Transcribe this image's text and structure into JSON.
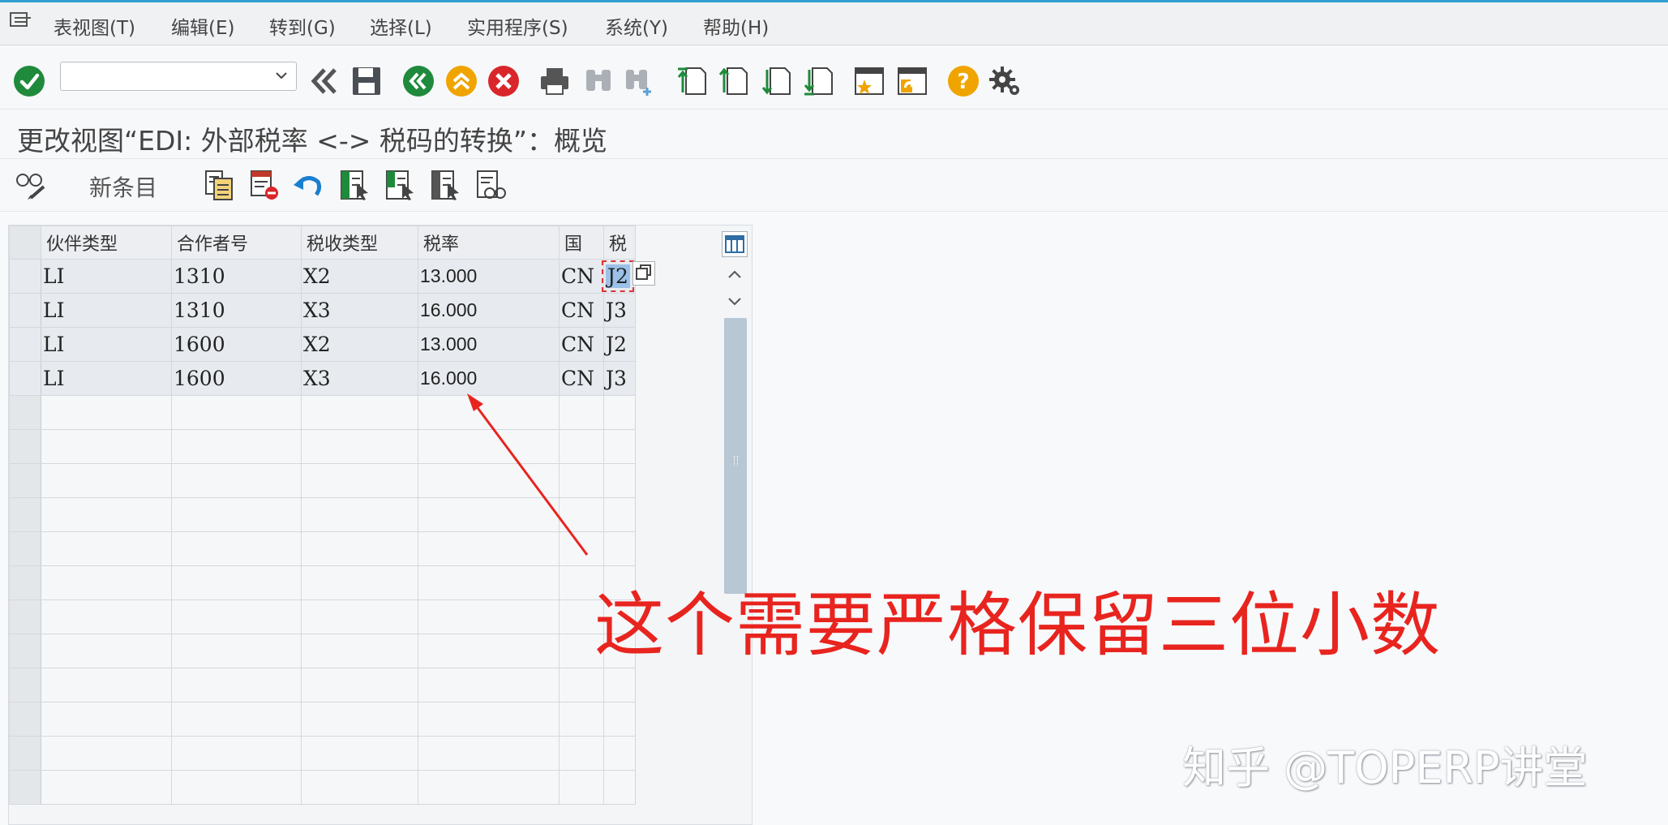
{
  "menu": {
    "items": [
      "表视图(T)",
      "编辑(E)",
      "转到(G)",
      "选择(L)",
      "实用程序(S)",
      "系统(Y)",
      "帮助(H)"
    ]
  },
  "toolbar": {
    "command_field_value": "",
    "icons": [
      "enter-check-icon",
      "command-field",
      "back-double-icon",
      "save-icon",
      "back-icon",
      "exit-icon",
      "cancel-icon",
      "print-icon",
      "find-icon",
      "find-next-icon",
      "first-page-icon",
      "prev-page-icon",
      "next-page-icon",
      "last-page-icon",
      "create-session-icon",
      "shortcut-icon",
      "help-icon",
      "settings-gear-icon"
    ]
  },
  "page": {
    "title": "更改视图“EDI: 外部税率 <-> 税码的转换”：概览"
  },
  "app_toolbar": {
    "new_entries_label": "新条目"
  },
  "table": {
    "columns": [
      "伙伴类型",
      "合作者号",
      "税收类型",
      "税率",
      "国",
      "税"
    ],
    "rows": [
      [
        "LI",
        "1310",
        "X2",
        "13.000",
        "CN",
        "J2"
      ],
      [
        "LI",
        "1310",
        "X3",
        "16.000",
        "CN",
        "J3"
      ],
      [
        "LI",
        "1600",
        "X2",
        "13.000",
        "CN",
        "J2"
      ],
      [
        "LI",
        "1600",
        "X3",
        "16.000",
        "CN",
        "J3"
      ]
    ],
    "empty_rows": 12
  },
  "annotation": {
    "text": "这个需要严格保留三位小数",
    "color": "#e8241f"
  },
  "watermark": {
    "text": "知乎 @TOPERP讲堂"
  },
  "colors": {
    "accent_green": "#1f8a3b",
    "accent_orange": "#f0a400",
    "accent_red": "#d9262b",
    "selection_blue": "#9cc1e8"
  }
}
